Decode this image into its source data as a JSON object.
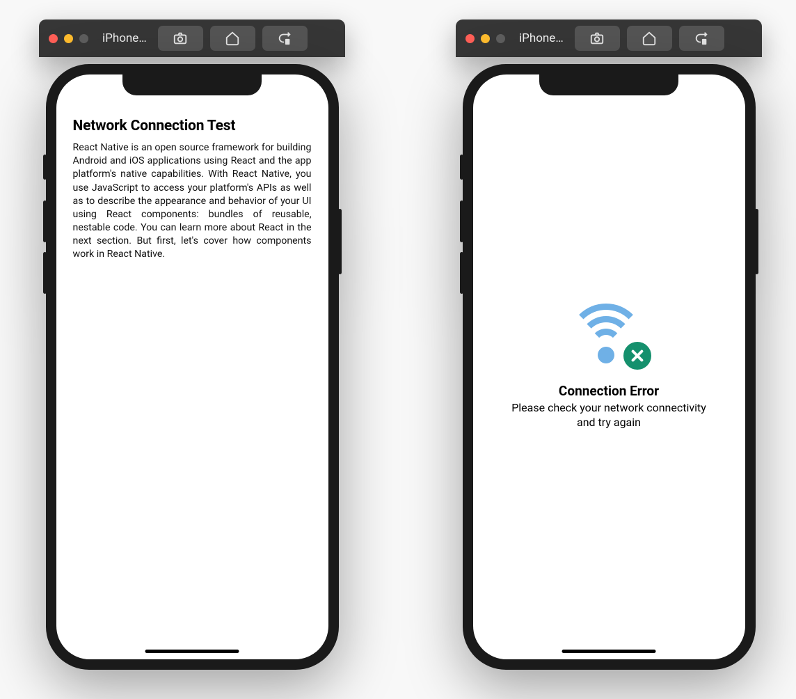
{
  "simulators": [
    {
      "title": "iPhone…",
      "content": {
        "heading": "Network Connection Test",
        "body": "React Native is an open source framework for building Android and iOS applications using React and the app platform's native capabilities. With React Native, you use JavaScript to access your platform's APIs as well as to describe the appearance and behavior of your UI using React components: bundles of reusable, nestable code. You can learn more about React in the next section. But first, let's cover how components work in React Native."
      }
    },
    {
      "title": "iPhone…",
      "error": {
        "title": "Connection Error",
        "message": "Please check your network connectivity and try again"
      }
    }
  ],
  "toolbar_icons": [
    "screenshot-icon",
    "home-icon",
    "rotate-icon"
  ]
}
